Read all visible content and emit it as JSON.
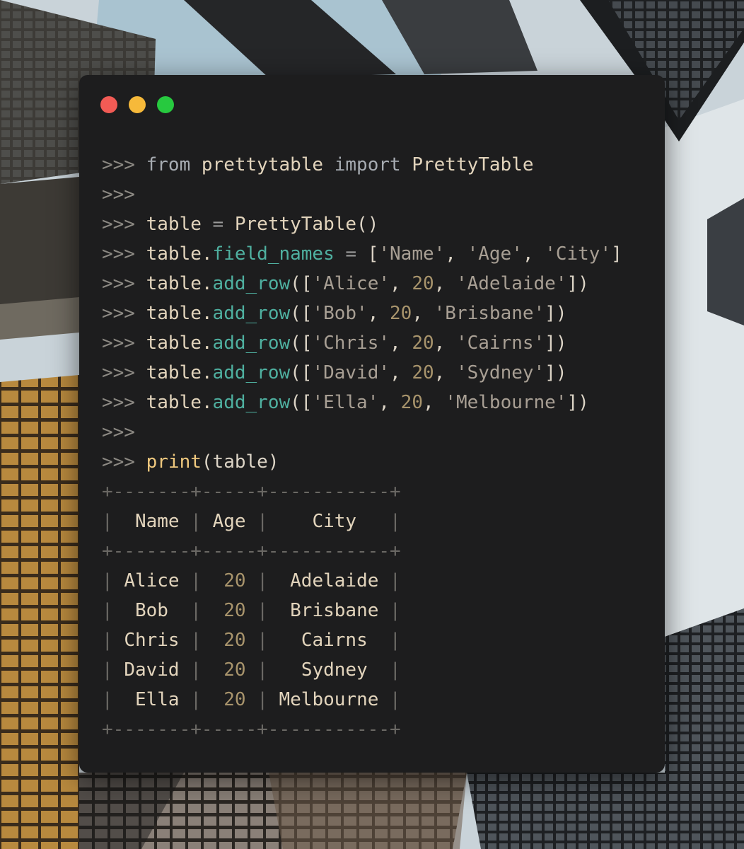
{
  "window": {
    "buttons": {
      "close_color": "#f25b55",
      "minimize_color": "#f6b93a",
      "maximize_color": "#27c93f"
    }
  },
  "code": {
    "prompt": ">>>",
    "lines": [
      {
        "parts": [
          {
            "t": "from",
            "c": "kw"
          },
          {
            "t": " prettytable ",
            "c": "cell"
          },
          {
            "t": "import",
            "c": "kw"
          },
          {
            "t": " PrettyTable",
            "c": "cell"
          }
        ]
      },
      {
        "parts": []
      },
      {
        "parts": [
          {
            "t": "table ",
            "c": "cell"
          },
          {
            "t": "=",
            "c": "op"
          },
          {
            "t": " PrettyTable",
            "c": "cell"
          },
          {
            "t": "()",
            "c": "punct"
          }
        ]
      },
      {
        "parts": [
          {
            "t": "table.",
            "c": "cell"
          },
          {
            "t": "field_names",
            "c": "method"
          },
          {
            "t": " = ",
            "c": "op"
          },
          {
            "t": "[",
            "c": "punct"
          },
          {
            "t": "'Name'",
            "c": "str"
          },
          {
            "t": ", ",
            "c": "punct"
          },
          {
            "t": "'Age'",
            "c": "str"
          },
          {
            "t": ", ",
            "c": "punct"
          },
          {
            "t": "'City'",
            "c": "str"
          },
          {
            "t": "]",
            "c": "punct"
          }
        ]
      },
      {
        "parts": [
          {
            "t": "table.",
            "c": "cell"
          },
          {
            "t": "add_row",
            "c": "method"
          },
          {
            "t": "([",
            "c": "punct"
          },
          {
            "t": "'Alice'",
            "c": "str"
          },
          {
            "t": ", ",
            "c": "punct"
          },
          {
            "t": "20",
            "c": "num"
          },
          {
            "t": ", ",
            "c": "punct"
          },
          {
            "t": "'Adelaide'",
            "c": "str"
          },
          {
            "t": "])",
            "c": "punct"
          }
        ]
      },
      {
        "parts": [
          {
            "t": "table.",
            "c": "cell"
          },
          {
            "t": "add_row",
            "c": "method"
          },
          {
            "t": "([",
            "c": "punct"
          },
          {
            "t": "'Bob'",
            "c": "str"
          },
          {
            "t": ", ",
            "c": "punct"
          },
          {
            "t": "20",
            "c": "num"
          },
          {
            "t": ", ",
            "c": "punct"
          },
          {
            "t": "'Brisbane'",
            "c": "str"
          },
          {
            "t": "])",
            "c": "punct"
          }
        ]
      },
      {
        "parts": [
          {
            "t": "table.",
            "c": "cell"
          },
          {
            "t": "add_row",
            "c": "method"
          },
          {
            "t": "([",
            "c": "punct"
          },
          {
            "t": "'Chris'",
            "c": "str"
          },
          {
            "t": ", ",
            "c": "punct"
          },
          {
            "t": "20",
            "c": "num"
          },
          {
            "t": ", ",
            "c": "punct"
          },
          {
            "t": "'Cairns'",
            "c": "str"
          },
          {
            "t": "])",
            "c": "punct"
          }
        ]
      },
      {
        "parts": [
          {
            "t": "table.",
            "c": "cell"
          },
          {
            "t": "add_row",
            "c": "method"
          },
          {
            "t": "([",
            "c": "punct"
          },
          {
            "t": "'David'",
            "c": "str"
          },
          {
            "t": ", ",
            "c": "punct"
          },
          {
            "t": "20",
            "c": "num"
          },
          {
            "t": ", ",
            "c": "punct"
          },
          {
            "t": "'Sydney'",
            "c": "str"
          },
          {
            "t": "])",
            "c": "punct"
          }
        ]
      },
      {
        "parts": [
          {
            "t": "table.",
            "c": "cell"
          },
          {
            "t": "add_row",
            "c": "method"
          },
          {
            "t": "([",
            "c": "punct"
          },
          {
            "t": "'Ella'",
            "c": "str"
          },
          {
            "t": ", ",
            "c": "punct"
          },
          {
            "t": "20",
            "c": "num"
          },
          {
            "t": ", ",
            "c": "punct"
          },
          {
            "t": "'Melbourne'",
            "c": "str"
          },
          {
            "t": "])",
            "c": "punct"
          }
        ]
      },
      {
        "parts": []
      },
      {
        "parts": [
          {
            "t": "print",
            "c": "fn"
          },
          {
            "t": "(table)",
            "c": "punct"
          }
        ]
      }
    ]
  },
  "output_table": {
    "border": "+-------+-----+-----------+",
    "header": [
      "Name",
      "Age",
      "City"
    ],
    "rows": [
      [
        "Alice",
        "20",
        "Adelaide"
      ],
      [
        "Bob",
        "20",
        "Brisbane"
      ],
      [
        "Chris",
        "20",
        "Cairns"
      ],
      [
        "David",
        "20",
        "Sydney"
      ],
      [
        "Ella",
        "20",
        "Melbourne"
      ]
    ]
  }
}
